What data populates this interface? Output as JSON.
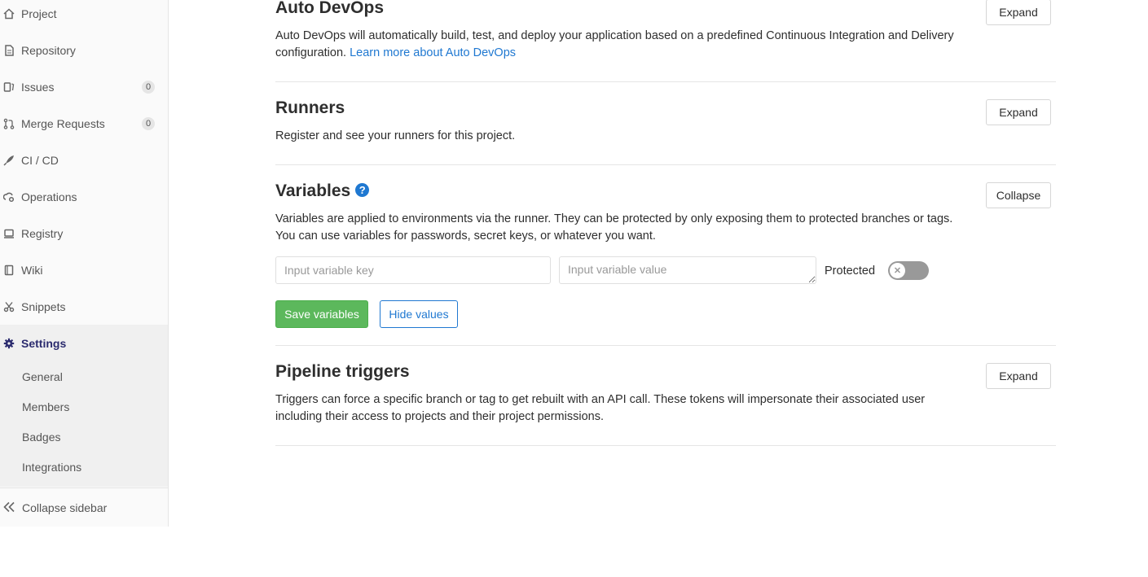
{
  "sidebar": {
    "items": [
      {
        "label": "Project",
        "icon": "home-icon"
      },
      {
        "label": "Repository",
        "icon": "doc-icon"
      },
      {
        "label": "Issues",
        "icon": "issues-icon",
        "count": "0"
      },
      {
        "label": "Merge Requests",
        "icon": "merge-request-icon",
        "count": "0"
      },
      {
        "label": "CI / CD",
        "icon": "rocket-icon"
      },
      {
        "label": "Operations",
        "icon": "cloud-gear-icon"
      },
      {
        "label": "Registry",
        "icon": "container-icon"
      },
      {
        "label": "Wiki",
        "icon": "book-icon"
      },
      {
        "label": "Snippets",
        "icon": "scissors-icon"
      },
      {
        "label": "Settings",
        "icon": "gear-icon"
      }
    ],
    "settings_sub": [
      "General",
      "Members",
      "Badges",
      "Integrations"
    ],
    "collapse_label": "Collapse sidebar"
  },
  "sections": {
    "auto_devops": {
      "title": "Auto DevOps",
      "desc": "Auto DevOps will automatically build, test, and deploy your application based on a predefined Continuous Integration and Delivery configuration.",
      "link": "Learn more about Auto DevOps",
      "button": "Expand"
    },
    "runners": {
      "title": "Runners",
      "desc": "Register and see your runners for this project.",
      "button": "Expand"
    },
    "variables": {
      "title": "Variables",
      "desc": "Variables are applied to environments via the runner. They can be protected by only exposing them to protected branches or tags. You can use variables for passwords, secret keys, or whatever you want.",
      "button": "Collapse",
      "key_placeholder": "Input variable key",
      "value_placeholder": "Input variable value",
      "protected_label": "Protected",
      "protected_on": false,
      "save_label": "Save variables",
      "hide_label": "Hide values"
    },
    "triggers": {
      "title": "Pipeline triggers",
      "desc": "Triggers can force a specific branch or tag to get rebuilt with an API call. These tokens will impersonate their associated user including their access to projects and their project permissions.",
      "button": "Expand"
    }
  },
  "colors": {
    "link": "#1f78d1",
    "save_button": "#5cb85c",
    "toggle_off": "#999999"
  }
}
